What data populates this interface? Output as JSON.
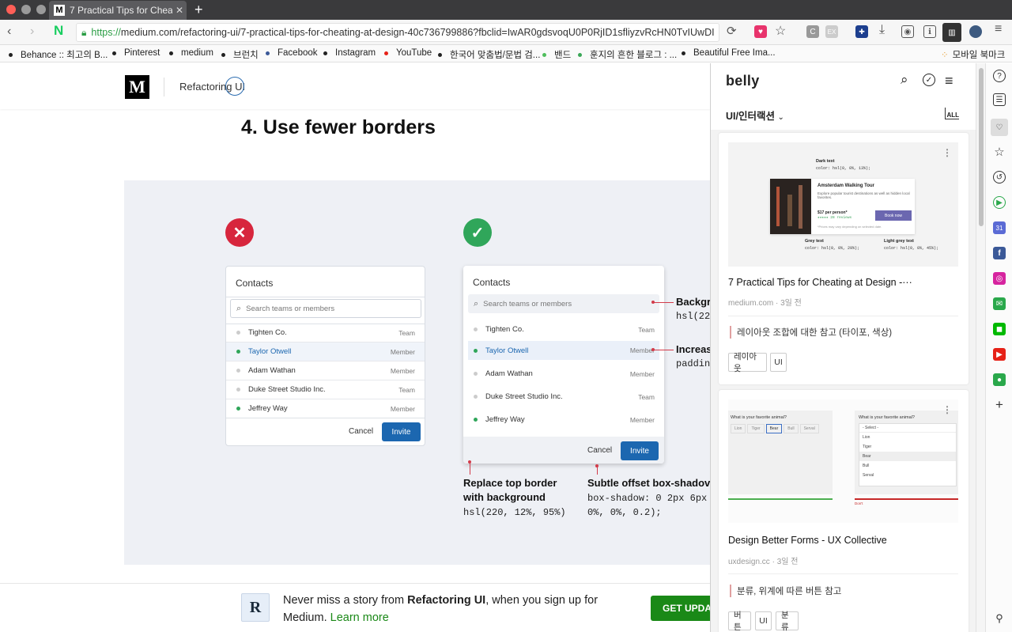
{
  "browser": {
    "tab_title": "7 Practical Tips for Cheat",
    "tab_favicon": "M",
    "url_proto": "https://",
    "url_rest": "medium.com/refactoring-ui/7-practical-tips-for-cheating-at-design-40c736799886?fbclid=IwAR0gdsvoqU0P0RjID1sfliyzvRcHN0TvIUwDI",
    "ext_c": "C",
    "ext_ex": "EX"
  },
  "bookmarks": [
    {
      "label": "Behance :: 최고의 B...",
      "color": "#222"
    },
    {
      "label": "Pinterest",
      "color": "#222"
    },
    {
      "label": "medium",
      "color": "#222"
    },
    {
      "label": "브런치",
      "color": "#222"
    },
    {
      "label": "Facebook",
      "color": "#3b5998"
    },
    {
      "label": "Instagram",
      "color": "#222"
    },
    {
      "label": "YouTube",
      "color": "#e62117"
    },
    {
      "label": "한국어 맞춤법/문법 검...",
      "color": "#222"
    },
    {
      "label": "밴드",
      "color": "#4fbe5c"
    },
    {
      "label": "훈지의 흔한 블로그 : ...",
      "color": "#3aa757"
    },
    {
      "label": "Beautiful Free Ima...",
      "color": "#222"
    }
  ],
  "mobile_bookmarks": "모바일 북마크",
  "medium": {
    "logo": "M",
    "publication": "Refactoring UI",
    "heading": "4. Use fewer borders"
  },
  "figure": {
    "bad_icon": "✕",
    "good_icon": "✓",
    "contacts_title": "Contacts",
    "search_placeholder": "Search teams or members",
    "rows": [
      {
        "name": "Tighten Co.",
        "role": "Team",
        "active": false
      },
      {
        "name": "Taylor Otwell",
        "role": "Member",
        "active": true
      },
      {
        "name": "Adam Wathan",
        "role": "Member",
        "active": false
      },
      {
        "name": "Duke Street Studio Inc.",
        "role": "Team",
        "active": false
      },
      {
        "name": "Jeffrey Way",
        "role": "Member",
        "active": true
      }
    ],
    "cancel": "Cancel",
    "invite": "Invite",
    "ann_bg_title": "Backgr",
    "ann_bg_code": "hsl(22",
    "ann_pad_title": "Increas",
    "ann_pad_code": "paddin",
    "ann_top_title": "Replace top border",
    "ann_top_title2": "with background",
    "ann_top_code": "hsl(220, 12%, 95%)",
    "ann_shadow_title": "Subtle offset box-shadov",
    "ann_shadow_code": "box-shadow: 0 2px 6px",
    "ann_shadow_code2": "0%, 0%, 0.2);"
  },
  "footer": {
    "logo": "R",
    "msg_pre": "Never miss a story from ",
    "msg_pub": "Refactoring UI",
    "msg_post": ", when you sign up for",
    "msg_line2": "Medium. ",
    "learn_more": "Learn more",
    "cta": "GET UPDATES"
  },
  "belly": {
    "logo": "belly",
    "category": "UI/인터랙션",
    "all_label": "ALL",
    "cards": [
      {
        "title": "7 Practical Tips for Cheating at Design -···",
        "source": "medium.com · 3일 전",
        "note": "레이아웃 조합에 대한 참고 (타이포, 색상)",
        "tags": [
          "레이아웃",
          "UI"
        ]
      },
      {
        "title": "Design Better Forms - UX Collective",
        "source": "uxdesign.cc · 3일 전",
        "note": "분류, 위계에 따른 버튼 참고",
        "tags": [
          "버튼",
          "UI",
          "분류"
        ]
      }
    ],
    "thumb1": {
      "dark_text": "Dark text",
      "dark_code": "color: hsl(0, 0%, 13%);",
      "card_title": "Amsterdam Walking Tour",
      "card_desc": "Explore popular tourist destinations as well as hidden local favorites.",
      "price": "$17 per person*",
      "reviews": "★★★★★ 28 reviews",
      "book": "Book now",
      "note": "*Prices may vary depending on selected date.",
      "grey_text": "Grey text",
      "grey_code": "color: hsl(0, 0%, 29%);",
      "light_text": "Light grey text",
      "light_code": "color: hsl(0, 0%, 45%);"
    },
    "thumb2": {
      "question": "What is your favorite animal?",
      "options": [
        "Lion",
        "Tiger",
        "Bear",
        "Bull",
        "Serval"
      ],
      "select": "- Select -",
      "dont": "Don't"
    }
  }
}
